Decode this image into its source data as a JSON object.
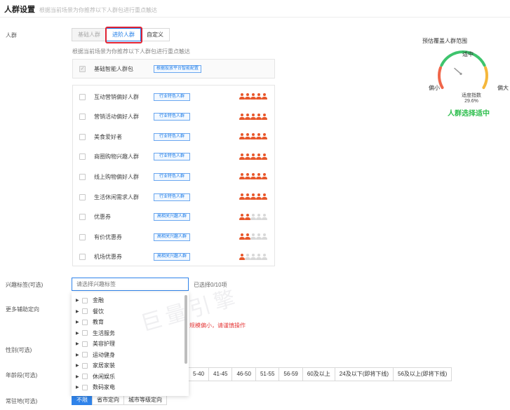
{
  "header": {
    "title": "人群设置",
    "subtitle": "根据当前场景为你推荐以下人群包进行重点触达"
  },
  "labels": {
    "crowd": "人群",
    "interest": "兴趣标签(可选)",
    "more_targeting": "更多辅助定向",
    "gender": "性别(可选)",
    "age": "年龄段(可选)",
    "residence": "常驻地(可选)"
  },
  "tabs": [
    {
      "label": "基础人群",
      "state": "disabled"
    },
    {
      "label": "进阶人群",
      "state": "active"
    },
    {
      "label": "自定义",
      "state": "normal"
    }
  ],
  "hint": "根据当前场景为你推荐以下人群包进行重点触达",
  "base_pack": {
    "name": "基础智能人群包",
    "tag": "根据投放平台智能配置",
    "checked": true
  },
  "crowd_items": [
    {
      "name": "互动营销偏好人群",
      "tag": "行业特色人群",
      "stars": 5
    },
    {
      "name": "营销活动偏好人群",
      "tag": "行业特色人群",
      "stars": 5
    },
    {
      "name": "美食爱好者",
      "tag": "行业特色人群",
      "stars": 5
    },
    {
      "name": "商圈购物兴趣人群",
      "tag": "行业特色人群",
      "stars": 5
    },
    {
      "name": "线上购物偏好人群",
      "tag": "行业特色人群",
      "stars": 5
    },
    {
      "name": "生活休闲需求人群",
      "tag": "行业特色人群",
      "stars": 5
    },
    {
      "name": "优惠券",
      "tag": "高相关兴趣人群",
      "stars": 2
    },
    {
      "name": "有价优惠券",
      "tag": "高相关兴趣人群",
      "stars": 1.5
    },
    {
      "name": "机场优惠券",
      "tag": "高相关兴趣人群",
      "stars": 1
    }
  ],
  "gauge": {
    "title": "预估覆盖人群范围",
    "top_label": "适中",
    "left_label": "偏小",
    "right_label": "偏大",
    "index_label": "适度指数",
    "index_value": "29.6%",
    "index_fraction": 0.296,
    "status": "人群选择适中",
    "colors": {
      "left": "#f0664a",
      "middle": "#3ec46d",
      "right": "#f5b73b"
    }
  },
  "interest": {
    "placeholder": "请选择兴趣标签",
    "selected_text": "已选择0/10项"
  },
  "dropdown_items": [
    "金融",
    "餐饮",
    "教育",
    "生活服务",
    "美容护理",
    "运动健身",
    "家居家装",
    "休闲娱乐",
    "数码家电"
  ],
  "watermark": "巨量引擎",
  "warning": "规模偏小，请谨慎操作",
  "age_options": [
    "5-40",
    "41-45",
    "46-50",
    "51-55",
    "56-59",
    "60及以上",
    "24及以下(即将下线)",
    "56及以上(即将下线)"
  ],
  "residence_options": [
    {
      "label": "不限",
      "active": true
    },
    {
      "label": "省市定向",
      "active": false
    },
    {
      "label": "城市等级定向",
      "active": false
    }
  ]
}
